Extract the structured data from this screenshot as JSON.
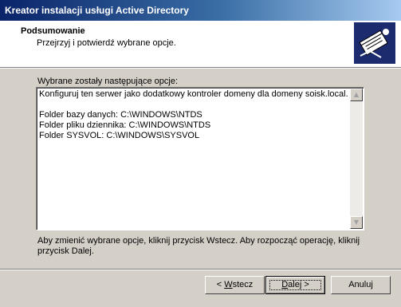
{
  "window": {
    "title": "Kreator instalacji usługi Active Directory"
  },
  "header": {
    "title": "Podsumowanie",
    "subtitle": "Przejrzyj i potwierdź wybrane opcje.",
    "icon": "active-directory-book-icon"
  },
  "main": {
    "prompt": "Wybrane zostały następujące opcje:",
    "summary_text": "Konfiguruj ten serwer jako dodatkowy kontroler domeny dla domeny soisk.local.\n\nFolder bazy danych: C:\\WINDOWS\\NTDS\nFolder pliku dziennika: C:\\WINDOWS\\NTDS\nFolder SYSVOL: C:\\WINDOWS\\SYSVOL",
    "footer": "Aby zmienić wybrane opcje, kliknij przycisk Wstecz. Aby rozpocząć operację, kliknij przycisk Dalej."
  },
  "buttons": {
    "back_prefix": "< ",
    "back_accel": "W",
    "back_rest": "stecz",
    "next_accel": "D",
    "next_rest": "alej >",
    "cancel": "Anuluj"
  },
  "colors": {
    "titlebar_start": "#0a246a",
    "titlebar_end": "#a6caf0",
    "face": "#d4d0c8",
    "icon_bg": "#1c2a6e"
  }
}
